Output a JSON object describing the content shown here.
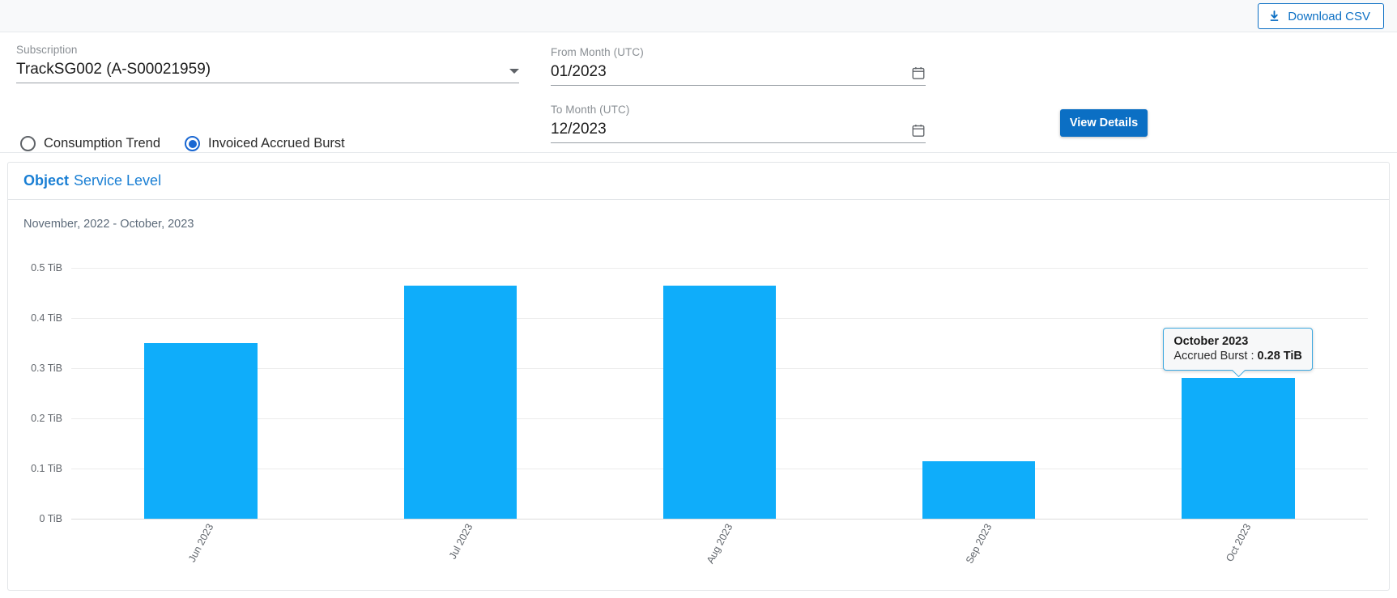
{
  "topbar": {
    "download_label": "Download CSV",
    "download_icon": "download-icon"
  },
  "filters": {
    "subscription": {
      "label": "Subscription",
      "value": "TrackSG002 (A-S00021959)",
      "caret_icon": "chevron-down-icon"
    },
    "from_month": {
      "label": "From Month (UTC)",
      "value": "01/2023",
      "calendar_icon": "calendar-icon"
    },
    "to_month": {
      "label": "To Month (UTC)",
      "value": "12/2023",
      "calendar_icon": "calendar-icon"
    },
    "radios": [
      {
        "label": "Consumption Trend",
        "selected": false
      },
      {
        "label": "Invoiced Accrued Burst",
        "selected": true
      }
    ],
    "view_details_label": "View Details"
  },
  "card": {
    "title_bold": "Object",
    "title_rest": "Service Level"
  },
  "colors": {
    "bar": "#0fadfa",
    "accent": "#0b6fc4",
    "radio_selected": "#1967d2",
    "title": "#1a7fd4"
  },
  "tooltip": {
    "title": "October 2023",
    "metric_label": "Accrued Burst :",
    "metric_value": "0.28 TiB"
  },
  "chart_data": {
    "type": "bar",
    "title": "Object Service Level",
    "subtitle": "November, 2022 - October, 2023",
    "categories": [
      "Jun 2023",
      "Jul 2023",
      "Aug 2023",
      "Sep 2023",
      "Oct 2023"
    ],
    "values": [
      0.35,
      0.465,
      0.465,
      0.115,
      0.28
    ],
    "series": [
      {
        "name": "Accrued Burst",
        "values": [
          0.35,
          0.465,
          0.465,
          0.115,
          0.28
        ]
      }
    ],
    "ytick_labels": [
      "0.5 TiB",
      "0.4 TiB",
      "0.3 TiB",
      "0.2 TiB",
      "0.1 TiB",
      "0 TiB"
    ],
    "ytick_values": [
      0.5,
      0.4,
      0.3,
      0.2,
      0.1,
      0
    ],
    "ylim": [
      0,
      0.5
    ],
    "unit": "TiB",
    "xlabel": "",
    "ylabel": "",
    "grid": true,
    "legend": "none"
  }
}
